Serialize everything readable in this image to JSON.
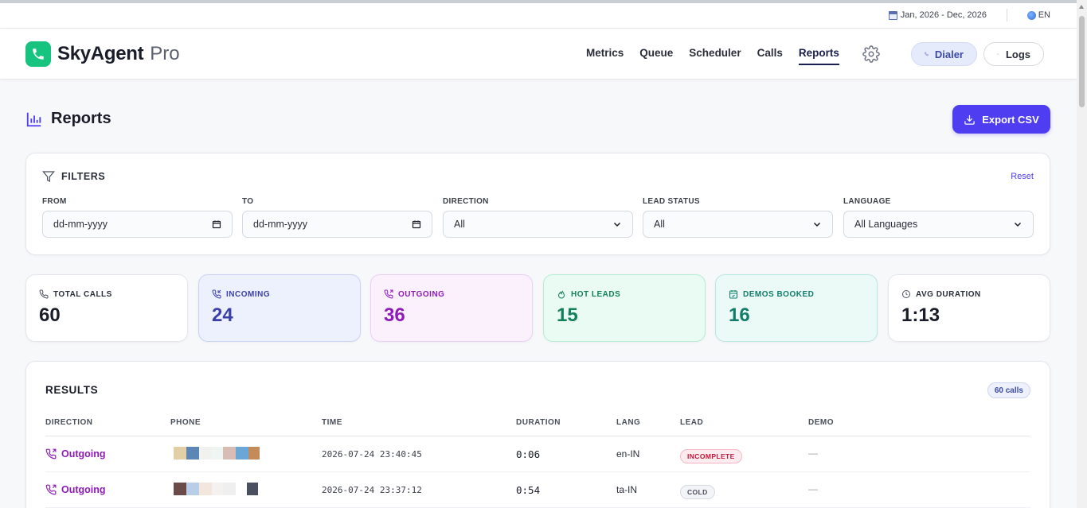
{
  "topbar": {
    "date_range": "Jan, 2026 - Dec, 2026",
    "language": "EN"
  },
  "brand": {
    "name": "SkyAgent",
    "suffix": "Pro"
  },
  "nav": {
    "items": [
      "Metrics",
      "Queue",
      "Scheduler",
      "Calls",
      "Reports"
    ],
    "active": "Reports"
  },
  "header_buttons": {
    "dialer": "Dialer",
    "logs": "Logs"
  },
  "page": {
    "title": "Reports",
    "export_label": "Export CSV"
  },
  "filters": {
    "title": "FILTERS",
    "reset": "Reset",
    "from": {
      "label": "FROM",
      "value": "dd-mm-yyyy"
    },
    "to": {
      "label": "TO",
      "value": "dd-mm-yyyy"
    },
    "direction": {
      "label": "DIRECTION",
      "value": "All"
    },
    "lead_status": {
      "label": "LEAD STATUS",
      "value": "All"
    },
    "language": {
      "label": "LANGUAGE",
      "value": "All Languages"
    }
  },
  "stats": [
    {
      "label": "TOTAL CALLS",
      "value": "60"
    },
    {
      "label": "INCOMING",
      "value": "24"
    },
    {
      "label": "OUTGOING",
      "value": "36"
    },
    {
      "label": "HOT LEADS",
      "value": "15"
    },
    {
      "label": "DEMOS BOOKED",
      "value": "16"
    },
    {
      "label": "AVG DURATION",
      "value": "1:13"
    }
  ],
  "results": {
    "title": "RESULTS",
    "count": "60 calls",
    "columns": [
      "DIRECTION",
      "PHONE",
      "TIME",
      "DURATION",
      "LANG",
      "LEAD",
      "DEMO"
    ],
    "rows": [
      {
        "direction": "Outgoing",
        "time": "2026-07-24 23:40:45",
        "duration": "0:06",
        "lang": "en-IN",
        "lead": "INCOMPLETE",
        "demo": "—"
      },
      {
        "direction": "Outgoing",
        "time": "2026-07-24 23:37:12",
        "duration": "0:54",
        "lang": "ta-IN",
        "lead": "COLD",
        "demo": "—"
      }
    ]
  },
  "colors": {
    "accent": "#4f3df2",
    "brand": "#16c47f",
    "outgoing": "#8d1bb8",
    "incoming": "#3b3fa8",
    "hot": "#12805c"
  }
}
